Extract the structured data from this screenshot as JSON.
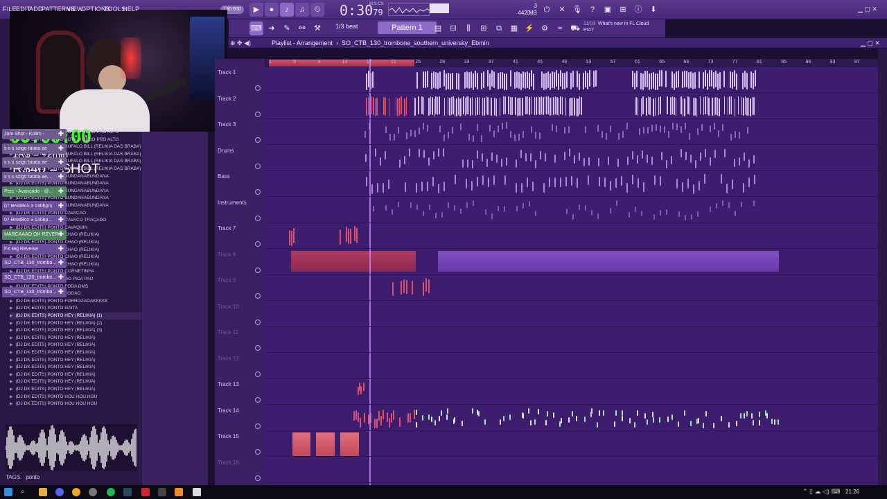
{
  "menu": [
    "FILE",
    "EDIT",
    "ADD",
    "PATTERNS",
    "VIEW",
    "OPTIONS",
    "TOOLS",
    "HELP"
  ],
  "transport": {
    "tempo": "130.000",
    "time": "0:30",
    "time_sub": "79",
    "time_unit": "M:S:CS",
    "mem": "442 MB",
    "cpu": "3",
    "voices": "0"
  },
  "toolbar": {
    "snap": "1/3 beat",
    "pattern": "Pattern 1",
    "news_number": "11/03",
    "news_text": "What's new in FL Cloud Pro?"
  },
  "overlay": {
    "stopwatch": "00:00:00",
    "rule1": "1R$ = +2min",
    "rule2": "R$40 = SHOT"
  },
  "browser": {
    "items": [
      "(DJ DK EDITS) PONTO BOTA O DEDO PRO ALTO",
      "(DJ DK EDITS) PONTO BOTA O DEDO PRO ALTO",
      "(DJ DK EDITS) PONTO BUFALO BILL (RELIKIA DAS BRABA)",
      "(DJ DK EDITS) PONTO BUFALO BILL (RELIKIA DAS BRABA)",
      "(DJ DK EDITS) PONTO BUFALO BILL (RELIKIA DAS BRABA)",
      "(DJ DK EDITS) PONTO BUFALO BILL (RELIKIA DAS BRABA)",
      "(DJ DK EDITS) PONTO BUNDANABUNDANA",
      "(DJ DK EDITS) PONTO BUNDANABUNDANA",
      "(DJ DK EDITS) PONTO BUNDANABUNDANA",
      "(DJ DK EDITS) PONTO BUNDANABUNDANA",
      "(DJ DK EDITS) PONTO BUNDANABUNDANA",
      "(DJ DK EDITS) PONTO CAVACAO",
      "(DJ DK EDITS) PONTO CAVACO TRAÇADO",
      "(DJ DK EDITS) PONTO CAVAQUIN",
      "(DJ DK EDITS) PONTO CHAO (RELIKIA)",
      "(DJ DK EDITS) PONTO CHAO (RELIKIA)",
      "(DJ DK EDITS) PONTO CHAO (RELIKIA)",
      "(DJ DK EDITS) PONTO CHAO (RELIKIA)",
      "(DJ DK EDITS) PONTO CHAO (RELIKIA)",
      "(DJ DK EDITS) PONTO CORNETINHA",
      "(DJ DK EDITS) PONTO DO PICA PAU",
      "(DJ DK EDITS) PONTO FODA DMS",
      "(DJ DK EDITS) PONTO FODAO",
      "(DJ DK EDITS) PONTO FORROZADAKKKKK",
      "(DJ DK EDITS) PONTO GAITA",
      "(DJ DK EDITS) PONTO HEY (RELIKIA) (1)",
      "(DJ DK EDITS) PONTO HEY (RELIKIA) (2)",
      "(DJ DK EDITS) PONTO HEY (RELIKIA) (3)",
      "(DJ DK EDITS) PONTO HEY (RELIKIA)",
      "(DJ DK EDITS) PONTO HEY (RELIKIA)",
      "(DJ DK EDITS) PONTO HEY (RELIKIA)",
      "(DJ DK EDITS) PONTO HEY (RELIKIA)",
      "(DJ DK EDITS) PONTO HEY (RELIKIA)",
      "(DJ DK EDITS) PONTO HEY (RELIKIA)",
      "(DJ DK EDITS) PONTO HEY (RELIKIA)",
      "(DJ DK EDITS) PONTO HEY (RELIKIA)",
      "(DJ DK EDITS) PONTO HOU HOU HOU",
      "(DJ DK EDITS) PONTO HOU HOU HOU"
    ],
    "tags_label": "TAGS",
    "tags_value": "ponto"
  },
  "picker": [
    {
      "label": "Jom Shot - Kotim -",
      "color": "#6d5b8f"
    },
    {
      "label": "s s s szigo tatata ae",
      "color": "#6d5b8f"
    },
    {
      "label": "s s s szigo tatata ae",
      "color": "#6d5b8f"
    },
    {
      "label": "s s s szigo tatata ae...",
      "color": "#6d5b8f"
    },
    {
      "label": "Perc - Avançado - @...",
      "color": "#4e8a5e"
    },
    {
      "label": "07 BeatBox 3 130bpm",
      "color": "#6b4f9c"
    },
    {
      "label": "07 BeatBox 3 130bp...",
      "color": "#6b4f9c"
    },
    {
      "label": "MARCAAAO OH REVER...",
      "color": "#4e8a5e"
    },
    {
      "label": "FX Big Reverse",
      "color": "#6b4f9c"
    },
    {
      "label": "SO_CTB_130_trombo...",
      "color": "#6b4f9c"
    },
    {
      "label": "SO_CTB_130_trombo...",
      "color": "#6b4f9c"
    },
    {
      "label": "SO_CTB_130_trombo...",
      "color": "#6b4f9c"
    }
  ],
  "playlist": {
    "title": "Playlist - Arrangement",
    "project": "SO_CTB_130_trombone_southern_university_Ebmin",
    "ruler": [
      "1",
      "5",
      "9",
      "13",
      "17",
      "21",
      "25",
      "29",
      "33",
      "37",
      "41",
      "45",
      "49",
      "53",
      "57",
      "61",
      "65",
      "69",
      "73",
      "77",
      "81",
      "85",
      "89",
      "93",
      "97"
    ],
    "tracks": [
      {
        "name": "Track 1",
        "dim": false
      },
      {
        "name": "Track 2",
        "dim": false
      },
      {
        "name": "Track 3",
        "dim": false
      },
      {
        "name": "Drums",
        "dim": false
      },
      {
        "name": "Bass",
        "dim": false
      },
      {
        "name": "Instruments",
        "dim": false
      },
      {
        "name": "Track 7",
        "dim": false
      },
      {
        "name": "Track 8",
        "dim": true
      },
      {
        "name": "Track 9",
        "dim": true
      },
      {
        "name": "Track 10",
        "dim": true
      },
      {
        "name": "Track 11",
        "dim": true
      },
      {
        "name": "Track 12",
        "dim": true
      },
      {
        "name": "Track 13",
        "dim": false
      },
      {
        "name": "Track 14",
        "dim": false
      },
      {
        "name": "Track 15",
        "dim": false
      },
      {
        "name": "Track 16",
        "dim": true
      }
    ]
  },
  "taskbar": {
    "clock": "21:26"
  },
  "colors": {
    "accent": "#8c6bc6",
    "stopwatch": "#39ff14",
    "clip_red": "#e0506a",
    "clip_purple": "#b77cf0",
    "clip_green": "#5ec97a"
  }
}
